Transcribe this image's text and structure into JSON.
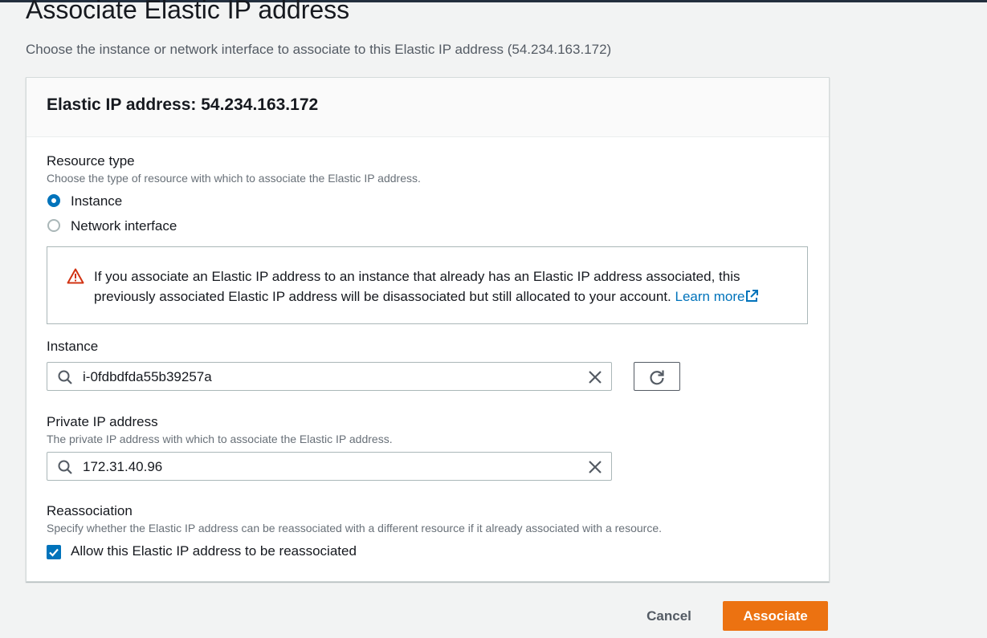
{
  "page": {
    "title": "Associate Elastic IP address",
    "description": "Choose the instance or network interface to associate to this Elastic IP address (54.234.163.172)"
  },
  "panel": {
    "title": "Elastic IP address: 54.234.163.172"
  },
  "resource_type": {
    "label": "Resource type",
    "description": "Choose the type of resource with which to associate the Elastic IP address.",
    "options": [
      {
        "label": "Instance",
        "selected": true
      },
      {
        "label": "Network interface",
        "selected": false
      }
    ]
  },
  "alert": {
    "icon": "warning-icon",
    "text": "If you associate an Elastic IP address to an instance that already has an Elastic IP address associated, this previously associated Elastic IP address will be disassociated but still allocated to your account.",
    "link_text": "Learn more",
    "color": "#d13212"
  },
  "instance": {
    "label": "Instance",
    "value": "i-0fdbdfda55b39257a"
  },
  "private_ip": {
    "label": "Private IP address",
    "description": "The private IP address with which to associate the Elastic IP address.",
    "value": "172.31.40.96"
  },
  "reassociation": {
    "label": "Reassociation",
    "description": "Specify whether the Elastic IP address can be reassociated with a different resource if it already associated with a resource.",
    "checkbox_label": "Allow this Elastic IP address to be reassociated",
    "checked": true
  },
  "actions": {
    "cancel_label": "Cancel",
    "associate_label": "Associate"
  },
  "colors": {
    "primary_button": "#ec7211",
    "accent": "#0073bb",
    "background": "#f2f3f3"
  }
}
